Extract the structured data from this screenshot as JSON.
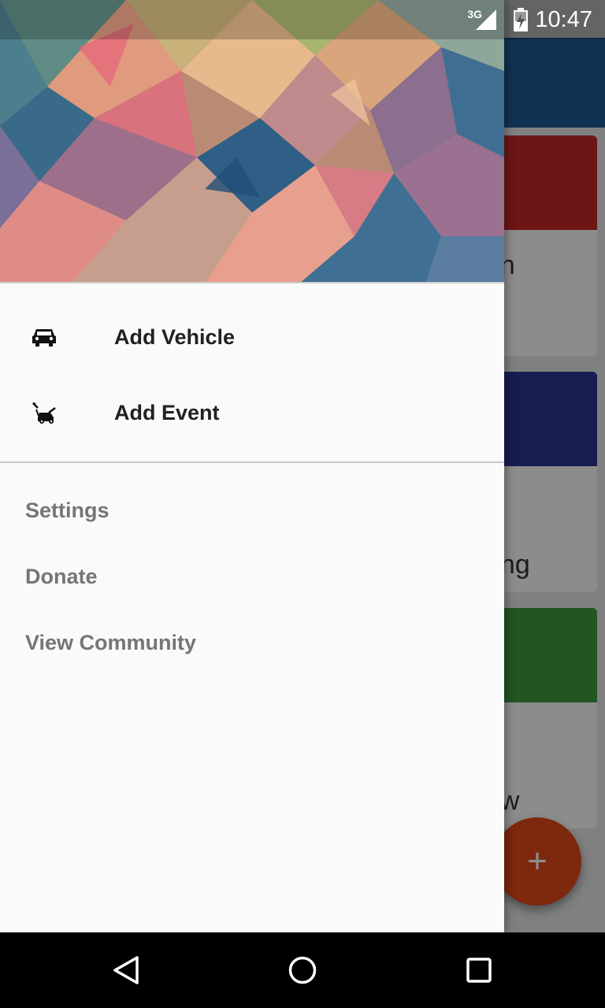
{
  "status_bar": {
    "network_type": "3G",
    "time": "10:47",
    "signal_icon": "cell-signal-icon",
    "battery_icon": "battery-charging-icon"
  },
  "background": {
    "card_labels": [
      "en",
      "ang",
      "ow"
    ],
    "card_colors": [
      "#c62828",
      "#283593",
      "#3f9b3f"
    ],
    "fab_label": "+",
    "fab_color": "#e64a19",
    "app_bar_color": "#1e5c96"
  },
  "drawer": {
    "header_image": "polygon-abstract-header-image",
    "primary_items": [
      {
        "label": "Add Vehicle",
        "icon": "car-icon"
      },
      {
        "label": "Add Event",
        "icon": "car-repair-icon"
      }
    ],
    "secondary_items": [
      {
        "label": "Settings"
      },
      {
        "label": "Donate"
      },
      {
        "label": "View Community"
      }
    ]
  },
  "nav_bar": {
    "back_icon": "back-triangle-icon",
    "home_icon": "home-circle-icon",
    "recents_icon": "recents-square-icon"
  }
}
